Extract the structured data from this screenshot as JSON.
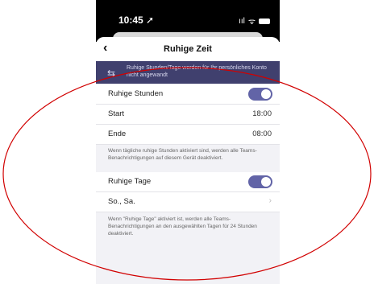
{
  "status": {
    "time": "10:45 ➚",
    "signal": "ııl",
    "wifi": "ᯤ"
  },
  "nav": {
    "back": "‹",
    "title": "Ruhige Zeit"
  },
  "banner": {
    "icon": "⇆",
    "text": "Ruhige Stunden/Tage werden für Ihr persönliches Konto nicht angewandt"
  },
  "quiet_hours": {
    "label": "Ruhige Stunden",
    "on": true
  },
  "start": {
    "label": "Start",
    "value": "18:00"
  },
  "end": {
    "label": "Ende",
    "value": "08:00"
  },
  "note1": "Wenn tägliche ruhige Stunden aktiviert sind, werden alle Teams-Benachrichtigungen auf diesem Gerät deaktiviert.",
  "quiet_days": {
    "label": "Ruhige Tage",
    "on": true
  },
  "days": {
    "value": "So., Sa.",
    "chevron": "›"
  },
  "note2": "Wenn \"Ruhige Tage\" aktiviert ist, werden alle Teams-Benachrichtigungen an den ausgewählten Tagen für 24 Stunden deaktiviert.",
  "annotation": {
    "color": "#d10000"
  }
}
